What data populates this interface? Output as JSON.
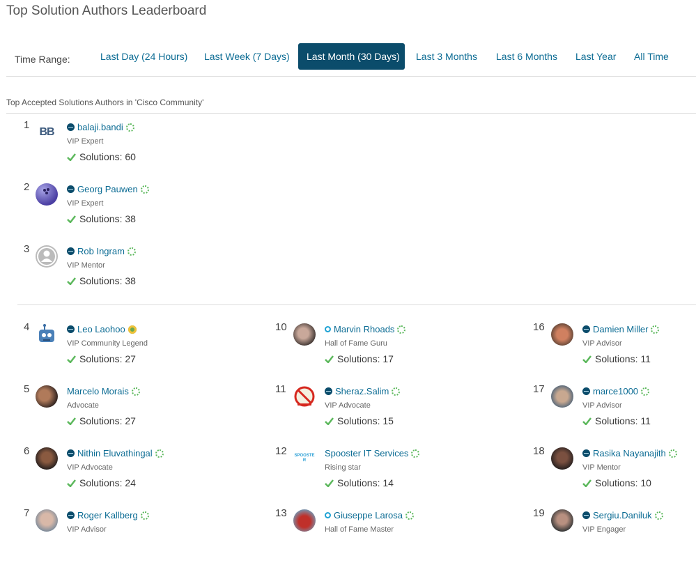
{
  "page_title": "Top Solution Authors Leaderboard",
  "time_range": {
    "label": "Time Range:",
    "tabs": [
      {
        "label": "Last Day (24 Hours)",
        "active": false
      },
      {
        "label": "Last Week (7 Days)",
        "active": false
      },
      {
        "label": "Last Month (30 Days)",
        "active": true
      },
      {
        "label": "Last 3 Months",
        "active": false
      },
      {
        "label": "Last 6 Months",
        "active": false
      },
      {
        "label": "Last Year",
        "active": false
      },
      {
        "label": "All Time",
        "active": false
      }
    ]
  },
  "subheading": "Top Accepted Solutions Authors in 'Cisco Community'",
  "colors": {
    "accent": "#0b4c6b",
    "link": "#0c6c94",
    "check": "#5cb85c"
  },
  "authors": [
    {
      "rank": "1",
      "name": "balaji.bandi",
      "title": "VIP Expert",
      "solutions": "Solutions: 60",
      "avatar": "BB",
      "rank_icon": "vip-icon"
    },
    {
      "rank": "2",
      "name": "Georg Pauwen",
      "title": "VIP Expert",
      "solutions": "Solutions: 38",
      "avatar": "bowling-ball",
      "rank_icon": "vip-icon"
    },
    {
      "rank": "3",
      "name": "Rob Ingram",
      "title": "VIP Mentor",
      "solutions": "Solutions: 38",
      "avatar": "default-user",
      "rank_icon": "vip-icon"
    },
    {
      "rank": "4",
      "name": "Leo Laohoo",
      "title": "VIP Community Legend",
      "solutions": "Solutions: 27",
      "avatar": "robot",
      "rank_icon": "vip-icon"
    },
    {
      "rank": "5",
      "name": "Marcelo Morais",
      "title": "Advocate",
      "solutions": "Solutions: 27",
      "avatar": "photo",
      "rank_icon": ""
    },
    {
      "rank": "6",
      "name": "Nithin Eluvathingal",
      "title": "VIP Advocate",
      "solutions": "Solutions: 24",
      "avatar": "photo",
      "rank_icon": "vip-icon"
    },
    {
      "rank": "7",
      "name": "Roger Kallberg",
      "title": "VIP Advisor",
      "solutions": "",
      "avatar": "photo",
      "rank_icon": "vip-icon"
    },
    {
      "rank": "10",
      "name": "Marvin Rhoads",
      "title": "Hall of Fame Guru",
      "solutions": "Solutions: 17",
      "avatar": "photo",
      "rank_icon": "hof-icon"
    },
    {
      "rank": "11",
      "name": "Sheraz.Salim",
      "title": "VIP Advocate",
      "solutions": "Solutions: 15",
      "avatar": "no-sign",
      "rank_icon": "vip-icon"
    },
    {
      "rank": "12",
      "name": "Spooster IT Services",
      "title": "Rising star",
      "solutions": "Solutions: 14",
      "avatar": "SPOOSTER",
      "rank_icon": ""
    },
    {
      "rank": "13",
      "name": "Giuseppe Larosa",
      "title": "Hall of Fame Master",
      "solutions": "",
      "avatar": "photo",
      "rank_icon": "hof-icon"
    },
    {
      "rank": "16",
      "name": "Damien Miller",
      "title": "VIP Advisor",
      "solutions": "Solutions: 11",
      "avatar": "photo",
      "rank_icon": "vip-icon"
    },
    {
      "rank": "17",
      "name": "marce1000",
      "title": "VIP Advisor",
      "solutions": "Solutions: 11",
      "avatar": "photo",
      "rank_icon": "vip-icon"
    },
    {
      "rank": "18",
      "name": "Rasika Nayanajith",
      "title": "VIP Mentor",
      "solutions": "Solutions: 10",
      "avatar": "photo",
      "rank_icon": "vip-icon"
    },
    {
      "rank": "19",
      "name": "Sergiu.Daniluk",
      "title": "VIP Engager",
      "solutions": "",
      "avatar": "photo",
      "rank_icon": "vip-icon"
    }
  ]
}
